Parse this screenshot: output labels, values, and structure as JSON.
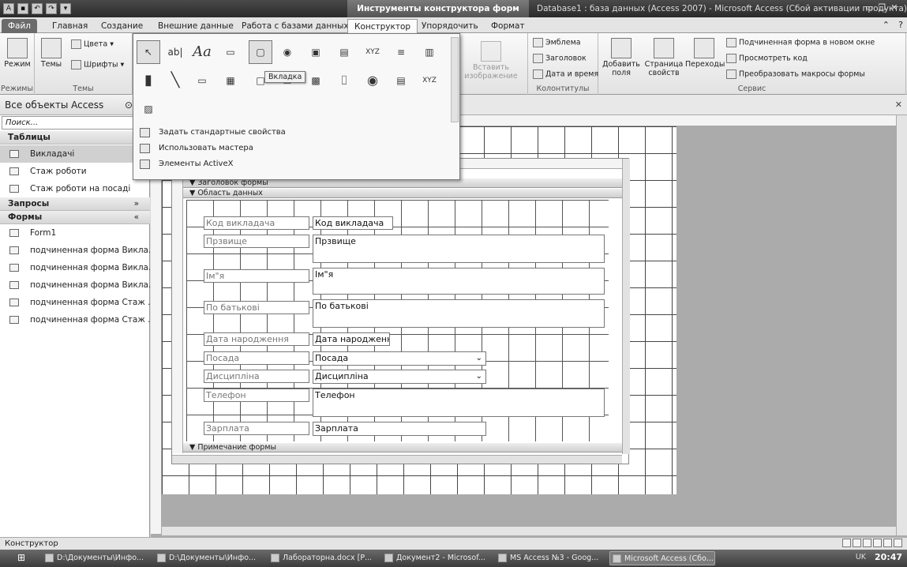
{
  "titlebar": {
    "context_title": "Инструменты конструктора форм",
    "app_title": "Database1 : база данных (Access 2007)  -  Microsoft Access (Сбой активации продукта)"
  },
  "tabs": [
    {
      "label": "Файл"
    },
    {
      "label": "Главная"
    },
    {
      "label": "Создание"
    },
    {
      "label": "Внешние данные"
    },
    {
      "label": "Работа с базами данных"
    },
    {
      "label": "Конструктор"
    },
    {
      "label": "Упорядочить"
    },
    {
      "label": "Формат"
    }
  ],
  "ribbon": {
    "views": {
      "btn": "Режим",
      "group": "Режимы"
    },
    "themes": {
      "themes": "Темы",
      "colors": "Цвета",
      "fonts": "Шрифты",
      "group": "Темы"
    },
    "insert_image": "Вставить изображение",
    "header_footer": {
      "logo": "Эмблема",
      "title": "Заголовок",
      "datetime": "Дата и время",
      "group": "Колонтитулы"
    },
    "tools": {
      "add_fields": "Добавить поля",
      "property_sheet": "Страница свойств",
      "tab_order": "Переходы",
      "subform": "Подчиненная форма в новом окне",
      "view_code": "Просмотреть код",
      "convert_macros": "Преобразовать макросы формы",
      "group": "Сервис"
    }
  },
  "controls_popup": {
    "tooltip": "Вкладка",
    "commands": [
      "Задать стандартные свойства",
      "Использовать мастера",
      "Элементы ActiveX"
    ]
  },
  "nav": {
    "title": "Все объекты Access",
    "search_placeholder": "Поиск...",
    "sections": [
      {
        "label": "Таблицы",
        "chev": "«"
      },
      {
        "label": "Запросы",
        "chev": "»"
      },
      {
        "label": "Формы",
        "chev": "«"
      }
    ],
    "tables": [
      "Викладачі",
      "Стаж роботи",
      "Стаж роботи на посаді"
    ],
    "forms": [
      "Form1",
      "подчиненная форма Викла...",
      "подчиненная форма Викла...",
      "подчиненная форма Викла...",
      "подчиненная форма Стаж ...",
      "подчиненная форма Стаж ..."
    ]
  },
  "subform": {
    "header": "Заголовок формы",
    "detail": "Область данных",
    "footer": "Примечание формы",
    "labels": [
      "Код викладача",
      "Прзвище",
      "Ім\"я",
      "По батькові",
      "Дата народження",
      "Посада",
      "Дисципліна",
      "Телефон",
      "Зарплата"
    ],
    "fields": [
      "Код викладача",
      "Прзвище",
      "Ім\"я",
      "По батькові",
      "Дата народженн",
      "Посада",
      "Дисципліна",
      "Телефон",
      "Зарплата"
    ]
  },
  "status": {
    "mode": "Конструктор"
  },
  "taskbar": {
    "items": [
      "D:\\Документы\\Инфо...",
      "D:\\Документы\\Инфо...",
      "Лабораторна.docx [Р...",
      "Документ2 - Microsof...",
      "MS Access №3 - Goog...",
      "Microsoft Access (Сбо..."
    ],
    "lang": "UK",
    "time": "20:47"
  }
}
